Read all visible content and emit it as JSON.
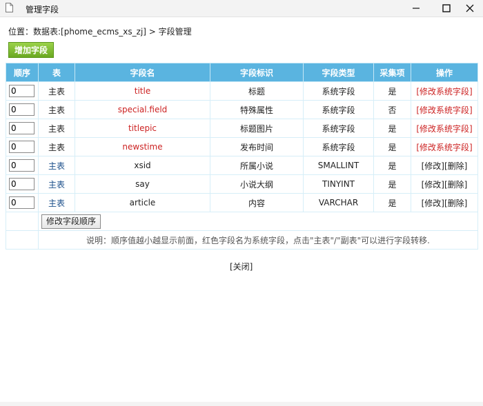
{
  "window": {
    "title": "管理字段"
  },
  "breadcrumb": {
    "prefix": "位置：",
    "table_link": "数据表:[phome_ecms_xs_zj]",
    "separator": " > ",
    "current": "字段管理"
  },
  "toolbar": {
    "add_field_label": "增加字段"
  },
  "table": {
    "headers": [
      "顺序",
      "表",
      "字段名",
      "字段标识",
      "字段类型",
      "采集项",
      "操作"
    ],
    "rows": [
      {
        "order": "0",
        "table": "主表",
        "field": "title",
        "label": "标题",
        "type": "系统字段",
        "collect": "是",
        "op1": "[修改系统字段]",
        "op2": ""
      },
      {
        "order": "0",
        "table": "主表",
        "field": "special.field",
        "label": "特殊属性",
        "type": "系统字段",
        "collect": "否",
        "op1": "[修改系统字段]",
        "op2": ""
      },
      {
        "order": "0",
        "table": "主表",
        "field": "titlepic",
        "label": "标题图片",
        "type": "系统字段",
        "collect": "是",
        "op1": "[修改系统字段]",
        "op2": ""
      },
      {
        "order": "0",
        "table": "主表",
        "field": "newstime",
        "label": "发布时间",
        "type": "系统字段",
        "collect": "是",
        "op1": "[修改系统字段]",
        "op2": ""
      },
      {
        "order": "0",
        "table": "主表",
        "field": "xsid",
        "label": "所属小说",
        "type": "SMALLINT",
        "collect": "是",
        "op1": "[修改]",
        "op2": "[删除]"
      },
      {
        "order": "0",
        "table": "主表",
        "field": "say",
        "label": "小说大纲",
        "type": "TINYINT",
        "collect": "是",
        "op1": "[修改]",
        "op2": "[删除]"
      },
      {
        "order": "0",
        "table": "主表",
        "field": "article",
        "label": "内容",
        "type": "VARCHAR",
        "collect": "是",
        "op1": "[修改]",
        "op2": "[删除]"
      }
    ],
    "modify_order_label": "修改字段顺序",
    "note": "说明：顺序值越小越显示前面，红色字段名为系统字段，点击\"主表\"/\"副表\"可以进行字段转移."
  },
  "footer": {
    "close_label": "[关闭]"
  },
  "colors": {
    "header_bg": "#5ab4e0",
    "system_field": "#cc2222",
    "table_link": "#1a4e8a",
    "add_button": "#7ab82e"
  }
}
